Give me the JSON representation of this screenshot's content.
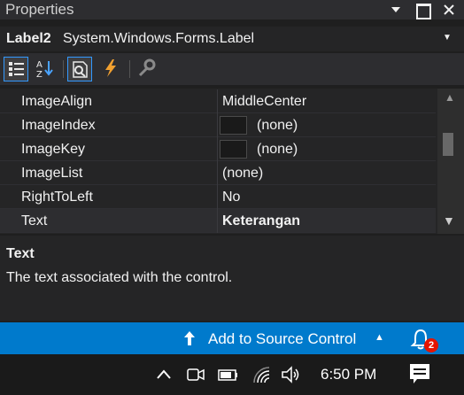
{
  "window": {
    "title": "Properties",
    "pin_glyph": "▼",
    "close_glyph": "✕"
  },
  "object_selector": {
    "name": "Label2",
    "type": "System.Windows.Forms.Label",
    "dropdown_glyph": "▼"
  },
  "toolbar": {
    "buttons": [
      "categorized-view-icon",
      "alphabetical-view-icon",
      "properties-icon",
      "events-lightning-icon",
      "property-pages-wrench-icon"
    ]
  },
  "properties": [
    {
      "name": "ImageAlign",
      "value": "MiddleCenter"
    },
    {
      "name": "ImageIndex",
      "value": "(none)"
    },
    {
      "name": "ImageKey",
      "value": "(none)"
    },
    {
      "name": "ImageList",
      "value": "(none)"
    },
    {
      "name": "RightToLeft",
      "value": "No"
    },
    {
      "name": "Text",
      "value": "Keterangan"
    }
  ],
  "scrollbar": {
    "up_glyph": "▲",
    "down_glyph": "▼"
  },
  "description": {
    "title": "Text",
    "text": "The text associated with the control."
  },
  "statusbar": {
    "source_control": "Add to Source Control",
    "caret": "▲",
    "notification_count": "2"
  },
  "taskbar": {
    "chevron": "∧",
    "time": "6:50 PM"
  },
  "colors": {
    "accent": "#007acc",
    "badge": "#e51400",
    "lightning": "#f0a030"
  }
}
